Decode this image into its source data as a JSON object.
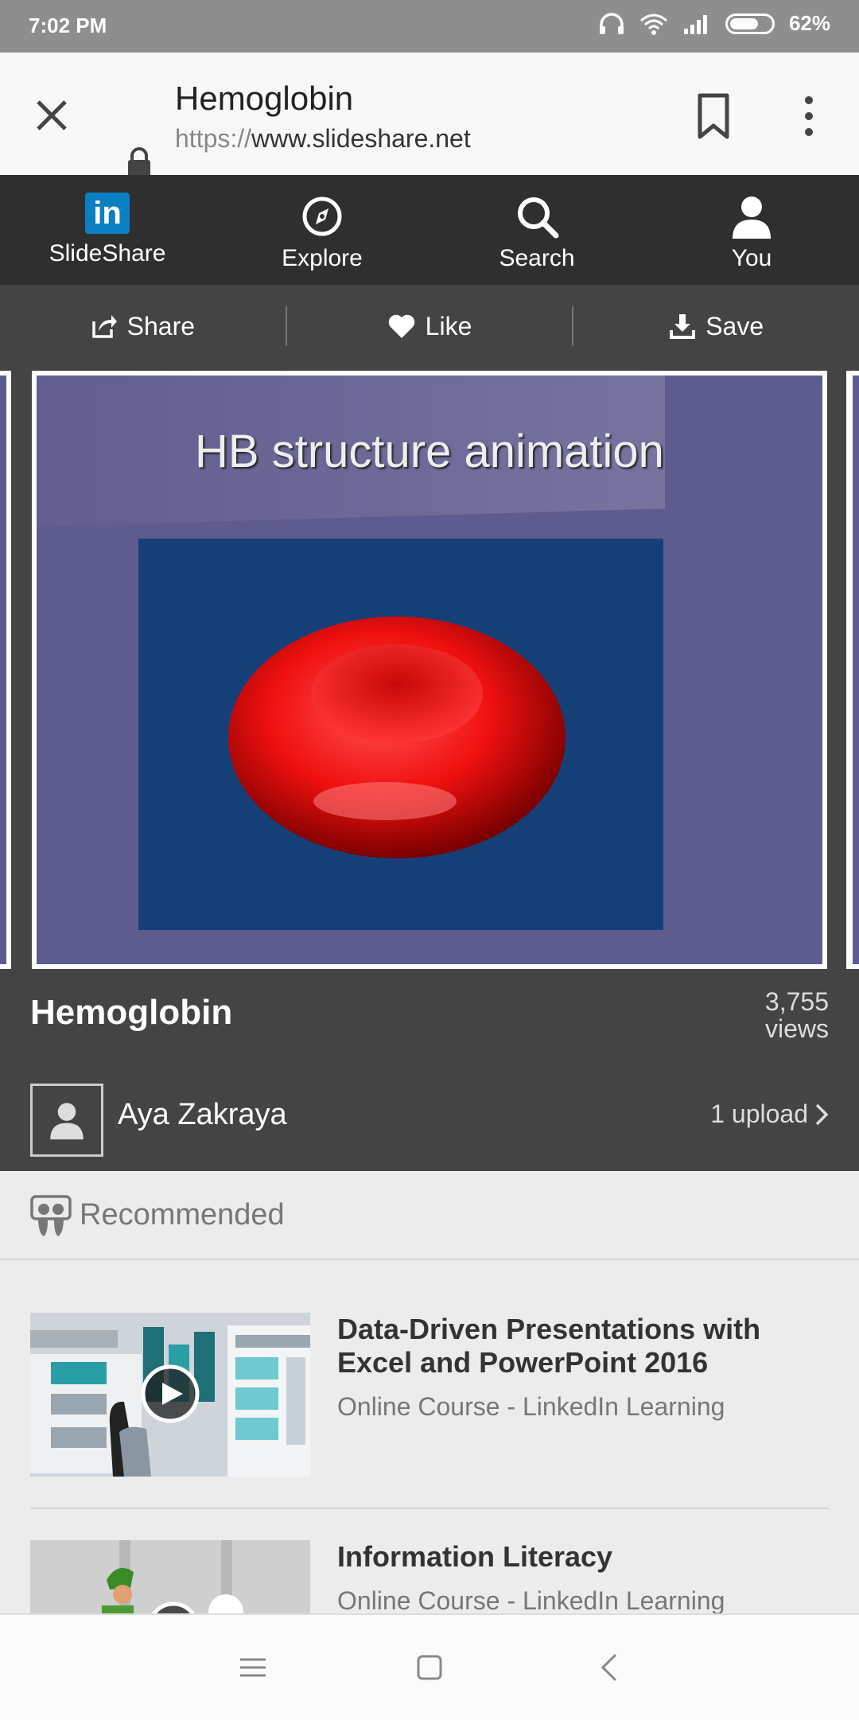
{
  "status_bar": {
    "time": "7:02 PM",
    "battery": "62%"
  },
  "browser": {
    "page_title": "Hemoglobin",
    "url_scheme": "https://",
    "url_host": "www.slideshare.net"
  },
  "nav": {
    "items": [
      {
        "label": "SlideShare",
        "icon": "linkedin-icon"
      },
      {
        "label": "Explore",
        "icon": "compass-icon"
      },
      {
        "label": "Search",
        "icon": "search-icon"
      },
      {
        "label": "You",
        "icon": "user-icon"
      }
    ]
  },
  "actions": {
    "share": "Share",
    "like": "Like",
    "save": "Save"
  },
  "slide": {
    "title": "HB structure animation"
  },
  "presentation": {
    "title": "Hemoglobin",
    "views_count": "3,755",
    "views_label": "views",
    "author": "Aya Zakraya",
    "uploads": "1 upload"
  },
  "recommended": {
    "heading": "Recommended",
    "items": [
      {
        "title": "Data-Driven Presentations with Excel and PowerPoint 2016",
        "subtitle": "Online Course - LinkedIn Learning"
      },
      {
        "title": "Information Literacy",
        "subtitle": "Online Course - LinkedIn Learning"
      }
    ]
  },
  "colors": {
    "accent": "#0b7fc2",
    "slide_bg": "#5e5b8e",
    "nav_bg": "#2f2f2f"
  }
}
